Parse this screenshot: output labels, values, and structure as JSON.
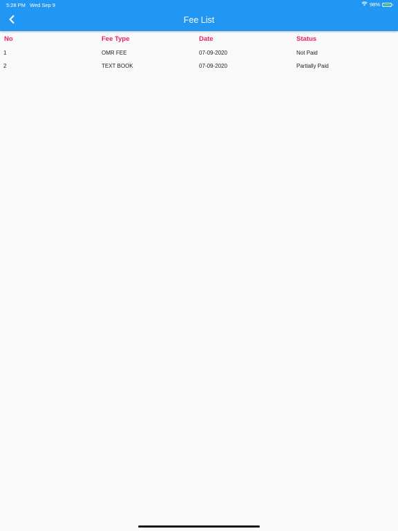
{
  "status_bar": {
    "time": "5:28 PM",
    "date": "Wed Sep 9",
    "battery_percent": "98%",
    "battery_level": 0.98
  },
  "header": {
    "title": "Fee List",
    "back_icon": "chevron-left-icon"
  },
  "table": {
    "columns": [
      "No",
      "Fee Type",
      "Date",
      "Status"
    ],
    "rows": [
      [
        "1",
        "OMR FEE",
        "07-09-2020",
        "Not Paid"
      ],
      [
        "2",
        "TEXT BOOK",
        "07-09-2020",
        "Partially Paid"
      ]
    ]
  },
  "colors": {
    "appbar": "#2196f3",
    "header_text": "#e91e63",
    "background": "#fafafa"
  }
}
